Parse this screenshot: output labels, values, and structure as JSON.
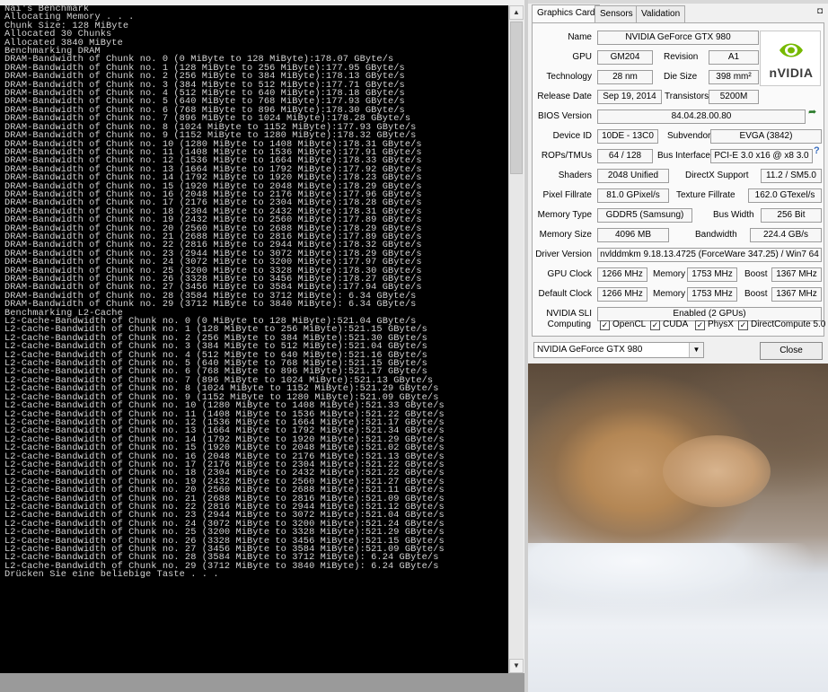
{
  "console": {
    "lines": [
      "Nai's Benchmark",
      "Allocating Memory . . .",
      "Chunk Size: 128 MiByte",
      "Allocated 30 Chunks",
      "Allocated 3840 MiByte",
      "Benchmarking DRAM",
      "DRAM-Bandwidth of Chunk no. 0 (0 MiByte to 128 MiByte):178.07 GByte/s",
      "DRAM-Bandwidth of Chunk no. 1 (128 MiByte to 256 MiByte):177.95 GByte/s",
      "DRAM-Bandwidth of Chunk no. 2 (256 MiByte to 384 MiByte):178.13 GByte/s",
      "DRAM-Bandwidth of Chunk no. 3 (384 MiByte to 512 MiByte):177.71 GByte/s",
      "DRAM-Bandwidth of Chunk no. 4 (512 MiByte to 640 MiByte):178.18 GByte/s",
      "DRAM-Bandwidth of Chunk no. 5 (640 MiByte to 768 MiByte):177.93 GByte/s",
      "DRAM-Bandwidth of Chunk no. 6 (768 MiByte to 896 MiByte):178.30 GByte/s",
      "DRAM-Bandwidth of Chunk no. 7 (896 MiByte to 1024 MiByte):178.28 GByte/s",
      "DRAM-Bandwidth of Chunk no. 8 (1024 MiByte to 1152 MiByte):177.93 GByte/s",
      "DRAM-Bandwidth of Chunk no. 9 (1152 MiByte to 1280 MiByte):178.32 GByte/s",
      "DRAM-Bandwidth of Chunk no. 10 (1280 MiByte to 1408 MiByte):178.31 GByte/s",
      "DRAM-Bandwidth of Chunk no. 11 (1408 MiByte to 1536 MiByte):177.91 GByte/s",
      "DRAM-Bandwidth of Chunk no. 12 (1536 MiByte to 1664 MiByte):178.33 GByte/s",
      "DRAM-Bandwidth of Chunk no. 13 (1664 MiByte to 1792 MiByte):177.92 GByte/s",
      "DRAM-Bandwidth of Chunk no. 14 (1792 MiByte to 1920 MiByte):178.23 GByte/s",
      "DRAM-Bandwidth of Chunk no. 15 (1920 MiByte to 2048 MiByte):178.29 GByte/s",
      "DRAM-Bandwidth of Chunk no. 16 (2048 MiByte to 2176 MiByte):177.96 GByte/s",
      "DRAM-Bandwidth of Chunk no. 17 (2176 MiByte to 2304 MiByte):178.28 GByte/s",
      "DRAM-Bandwidth of Chunk no. 18 (2304 MiByte to 2432 MiByte):178.31 GByte/s",
      "DRAM-Bandwidth of Chunk no. 19 (2432 MiByte to 2560 MiByte):177.89 GByte/s",
      "DRAM-Bandwidth of Chunk no. 20 (2560 MiByte to 2688 MiByte):178.29 GByte/s",
      "DRAM-Bandwidth of Chunk no. 21 (2688 MiByte to 2816 MiByte):177.89 GByte/s",
      "DRAM-Bandwidth of Chunk no. 22 (2816 MiByte to 2944 MiByte):178.32 GByte/s",
      "DRAM-Bandwidth of Chunk no. 23 (2944 MiByte to 3072 MiByte):178.29 GByte/s",
      "DRAM-Bandwidth of Chunk no. 24 (3072 MiByte to 3200 MiByte):177.97 GByte/s",
      "DRAM-Bandwidth of Chunk no. 25 (3200 MiByte to 3328 MiByte):178.30 GByte/s",
      "DRAM-Bandwidth of Chunk no. 26 (3328 MiByte to 3456 MiByte):178.27 GByte/s",
      "DRAM-Bandwidth of Chunk no. 27 (3456 MiByte to 3584 MiByte):177.94 GByte/s",
      "DRAM-Bandwidth of Chunk no. 28 (3584 MiByte to 3712 MiByte): 6.34 GByte/s",
      "DRAM-Bandwidth of Chunk no. 29 (3712 MiByte to 3840 MiByte): 6.34 GByte/s",
      "Benchmarking L2-Cache",
      "L2-Cache-Bandwidth of Chunk no. 0 (0 MiByte to 128 MiByte):521.04 GByte/s",
      "L2-Cache-Bandwidth of Chunk no. 1 (128 MiByte to 256 MiByte):521.15 GByte/s",
      "L2-Cache-Bandwidth of Chunk no. 2 (256 MiByte to 384 MiByte):521.30 GByte/s",
      "L2-Cache-Bandwidth of Chunk no. 3 (384 MiByte to 512 MiByte):521.04 GByte/s",
      "L2-Cache-Bandwidth of Chunk no. 4 (512 MiByte to 640 MiByte):521.16 GByte/s",
      "L2-Cache-Bandwidth of Chunk no. 5 (640 MiByte to 768 MiByte):521.15 GByte/s",
      "L2-Cache-Bandwidth of Chunk no. 6 (768 MiByte to 896 MiByte):521.17 GByte/s",
      "L2-Cache-Bandwidth of Chunk no. 7 (896 MiByte to 1024 MiByte):521.13 GByte/s",
      "L2-Cache-Bandwidth of Chunk no. 8 (1024 MiByte to 1152 MiByte):521.29 GByte/s",
      "L2-Cache-Bandwidth of Chunk no. 9 (1152 MiByte to 1280 MiByte):521.09 GByte/s",
      "L2-Cache-Bandwidth of Chunk no. 10 (1280 MiByte to 1408 MiByte):521.33 GByte/s",
      "L2-Cache-Bandwidth of Chunk no. 11 (1408 MiByte to 1536 MiByte):521.22 GByte/s",
      "L2-Cache-Bandwidth of Chunk no. 12 (1536 MiByte to 1664 MiByte):521.17 GByte/s",
      "L2-Cache-Bandwidth of Chunk no. 13 (1664 MiByte to 1792 MiByte):521.34 GByte/s",
      "L2-Cache-Bandwidth of Chunk no. 14 (1792 MiByte to 1920 MiByte):521.29 GByte/s",
      "L2-Cache-Bandwidth of Chunk no. 15 (1920 MiByte to 2048 MiByte):521.02 GByte/s",
      "L2-Cache-Bandwidth of Chunk no. 16 (2048 MiByte to 2176 MiByte):521.13 GByte/s",
      "L2-Cache-Bandwidth of Chunk no. 17 (2176 MiByte to 2304 MiByte):521.22 GByte/s",
      "L2-Cache-Bandwidth of Chunk no. 18 (2304 MiByte to 2432 MiByte):521.22 GByte/s",
      "L2-Cache-Bandwidth of Chunk no. 19 (2432 MiByte to 2560 MiByte):521.27 GByte/s",
      "L2-Cache-Bandwidth of Chunk no. 20 (2560 MiByte to 2688 MiByte):521.11 GByte/s",
      "L2-Cache-Bandwidth of Chunk no. 21 (2688 MiByte to 2816 MiByte):521.09 GByte/s",
      "L2-Cache-Bandwidth of Chunk no. 22 (2816 MiByte to 2944 MiByte):521.12 GByte/s",
      "L2-Cache-Bandwidth of Chunk no. 23 (2944 MiByte to 3072 MiByte):521.04 GByte/s",
      "L2-Cache-Bandwidth of Chunk no. 24 (3072 MiByte to 3200 MiByte):521.24 GByte/s",
      "L2-Cache-Bandwidth of Chunk no. 25 (3200 MiByte to 3328 MiByte):521.29 GByte/s",
      "L2-Cache-Bandwidth of Chunk no. 26 (3328 MiByte to 3456 MiByte):521.15 GByte/s",
      "L2-Cache-Bandwidth of Chunk no. 27 (3456 MiByte to 3584 MiByte):521.09 GByte/s",
      "L2-Cache-Bandwidth of Chunk no. 28 (3584 MiByte to 3712 MiByte): 6.24 GByte/s",
      "L2-Cache-Bandwidth of Chunk no. 29 (3712 MiByte to 3840 MiByte): 6.24 GByte/s",
      "Drücken Sie eine beliebige Taste . . ."
    ]
  },
  "gpuz": {
    "tabs": {
      "graphics_card": "Graphics Card",
      "sensors": "Sensors",
      "validation": "Validation"
    },
    "labels": {
      "name": "Name",
      "gpu": "GPU",
      "revision": "Revision",
      "technology": "Technology",
      "die_size": "Die Size",
      "release_date": "Release Date",
      "transistors": "Transistors",
      "bios_version": "BIOS Version",
      "device_id": "Device ID",
      "subvendor": "Subvendor",
      "rops_tmus": "ROPs/TMUs",
      "bus_interface": "Bus Interface",
      "shaders": "Shaders",
      "directx_support": "DirectX Support",
      "pixel_fillrate": "Pixel Fillrate",
      "texture_fillrate": "Texture Fillrate",
      "memory_type": "Memory Type",
      "bus_width": "Bus Width",
      "memory_size": "Memory Size",
      "bandwidth": "Bandwidth",
      "driver_version": "Driver Version",
      "gpu_clock": "GPU Clock",
      "memory": "Memory",
      "boost": "Boost",
      "default_clock": "Default Clock",
      "nvidia_sli": "NVIDIA SLI",
      "computing": "Computing"
    },
    "values": {
      "name": "NVIDIA GeForce GTX 980",
      "gpu": "GM204",
      "revision": "A1",
      "technology": "28 nm",
      "die_size": "398 mm²",
      "release_date": "Sep 19, 2014",
      "transistors": "5200M",
      "bios_version": "84.04.28.00.80",
      "device_id": "10DE - 13C0",
      "subvendor": "EVGA (3842)",
      "rops_tmus": "64 / 128",
      "bus_interface": "PCI-E 3.0 x16 @ x8 3.0",
      "shaders": "2048 Unified",
      "directx_support": "11.2 / SM5.0",
      "pixel_fillrate": "81.0 GPixel/s",
      "texture_fillrate": "162.0 GTexel/s",
      "memory_type": "GDDR5 (Samsung)",
      "bus_width": "256 Bit",
      "memory_size": "4096 MB",
      "bandwidth": "224.4 GB/s",
      "driver_version": "nvlddmkm 9.18.13.4725 (ForceWare 347.25) / Win7 64",
      "gpu_clock": "1266 MHz",
      "memory_clock": "1753 MHz",
      "boost_clock": "1367 MHz",
      "default_clock": "1266 MHz",
      "default_memory_clock": "1753 MHz",
      "default_boost_clock": "1367 MHz",
      "nvidia_sli": "Enabled (2 GPUs)"
    },
    "computing": [
      {
        "label": "OpenCL",
        "checked": true
      },
      {
        "label": "CUDA",
        "checked": true
      },
      {
        "label": "PhysX",
        "checked": true
      },
      {
        "label": "DirectCompute 5.0",
        "checked": true
      }
    ],
    "logo_text": "nVIDIA",
    "gpu_select": "NVIDIA GeForce GTX 980",
    "close_label": "Close",
    "check_mark": "✓",
    "help_mark": "?"
  },
  "colors": {
    "console_bg": "#000000",
    "console_text": "#d4d4d4",
    "nvidia_green": "#76b900"
  }
}
